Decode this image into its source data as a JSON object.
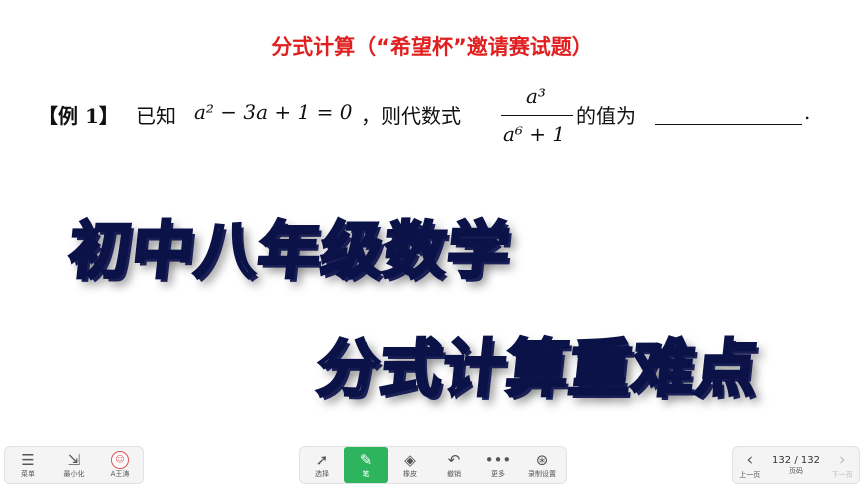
{
  "slide": {
    "title": "分式计算（“希望杯”邀请赛试题）",
    "example_label": "【例 1】",
    "intro_text": "已知",
    "equation": "a² − 3a + 1 = 0",
    "middle_text": "，则代数式",
    "fraction_numerator": "a³",
    "fraction_denominator": "a⁶ + 1",
    "after_text": "的值为",
    "end_mark": "."
  },
  "overlay": {
    "line1": "初中八年级数学",
    "line2": "分式计算重难点"
  },
  "toolbar": {
    "menu_label": "菜单",
    "minimize_label": "最小化",
    "user_label": "A王涛",
    "select_label": "选择",
    "pen_label": "笔",
    "eraser_label": "橡皮",
    "undo_label": "撤销",
    "more_label": "更多",
    "record_label": "录制设置",
    "prev_label": "上一页",
    "page_label": "页码",
    "next_label": "下一页",
    "page_indicator": "132 / 132",
    "accent_color": "#2fb45e"
  }
}
